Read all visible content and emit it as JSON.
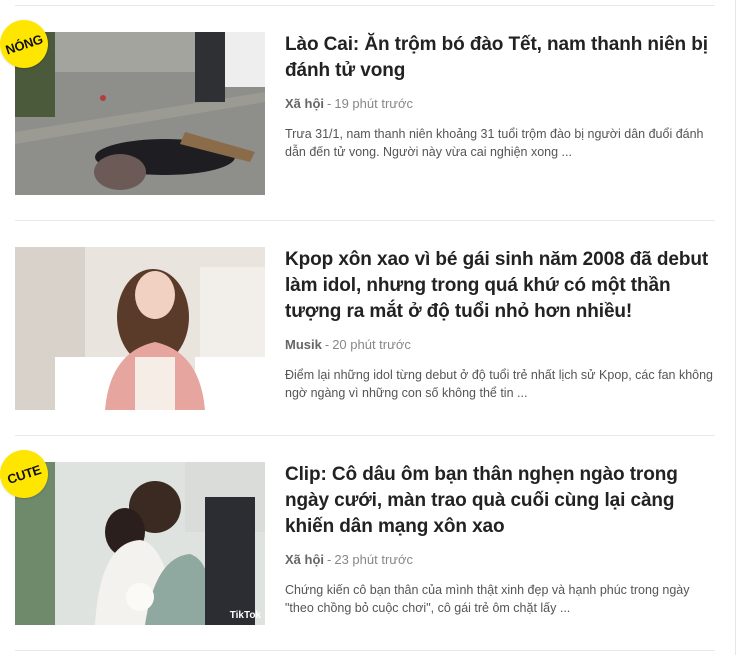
{
  "articles": [
    {
      "badge": "NÓNG",
      "title": "Lào Cai: Ăn trộm bó đào Tết, nam thanh niên bị đánh tử vong",
      "category": "Xã hội",
      "time": "19 phút trước",
      "summary": "Trưa 31/1, nam thanh niên khoảng 31 tuổi trộm đào bị người dân đuổi đánh dẫn đến tử vong. Người này vừa cai nghiện xong ..."
    },
    {
      "badge": "",
      "title": "Kpop xôn xao vì bé gái sinh năm 2008 đã debut làm idol, nhưng trong quá khứ có một thần tượng ra mắt ở độ tuổi nhỏ hơn nhiều!",
      "category": "Musik",
      "time": "20 phút trước",
      "summary": "Điểm lại những idol từng debut ở độ tuổi trẻ nhất lịch sử Kpop, các fan không ngờ ngàng vì những con số không thể tin ..."
    },
    {
      "badge": "CUTE",
      "title": "Clip: Cô dâu ôm bạn thân nghẹn ngào trong ngày cưới, màn trao quà cuối cùng lại càng khiến dân mạng xôn xao",
      "category": "Xã hội",
      "time": "23 phút trước",
      "summary": "Chứng kiến cô bạn thân của mình thật xinh đẹp và hạnh phúc trong ngày \"theo chồng bỏ cuộc chơi\", cô gái trẻ ôm chặt lấy ...",
      "watermark": "TikTok"
    }
  ],
  "separator": "-",
  "colors": {
    "badge": "#ffe600",
    "title": "#222222",
    "meta": "#888888"
  }
}
